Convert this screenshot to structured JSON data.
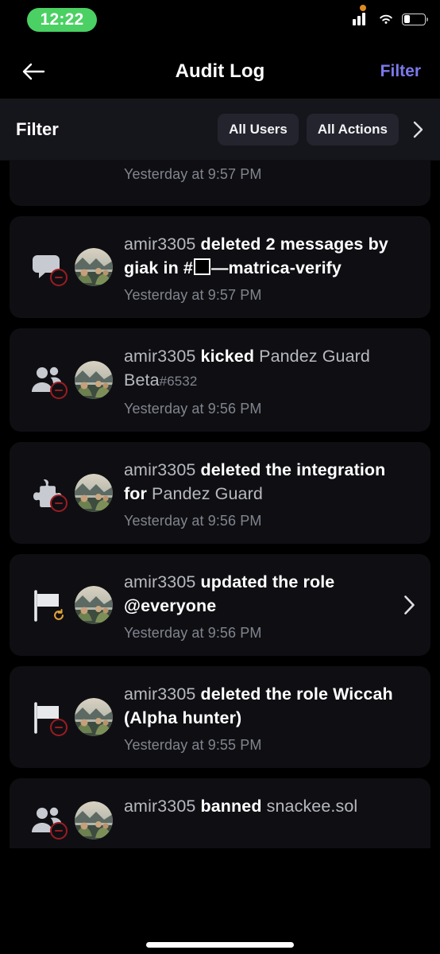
{
  "status_bar": {
    "time": "12:22",
    "time_pill_color": "#4ad063",
    "recording_dot_color": "#e08a1e",
    "icons": [
      "orange-dot",
      "cellular-signal",
      "wifi",
      "battery"
    ],
    "battery_level_percent": 30
  },
  "header": {
    "back_label": "back-arrow",
    "title": "Audit Log",
    "action_label": "Filter",
    "action_color": "#7b79ea"
  },
  "filter_bar": {
    "label": "Filter",
    "pills": [
      {
        "label": "All Users"
      },
      {
        "label": "All Actions"
      }
    ],
    "chevron": "chevron-right-icon"
  },
  "entries": [
    {
      "id": "entry-clipped-top",
      "clipped": true,
      "icon": "",
      "badge": "",
      "parts": [],
      "time": "Yesterday at 9:57 PM",
      "expandable": false
    },
    {
      "id": "entry-message-delete",
      "icon": "message-icon",
      "badge": "minus",
      "parts": [
        {
          "t": "amir3305 ",
          "s": "actor"
        },
        {
          "t": "deleted ",
          "s": "strong"
        },
        {
          "t": "2 messages",
          "s": "strong"
        },
        {
          "t": " by giak ",
          "s": "strong"
        },
        {
          "t": "in ",
          "s": "strong"
        },
        {
          "t": "#",
          "s": "strong"
        },
        {
          "t": "▯",
          "s": "tofu"
        },
        {
          "t": "—matrica-verify",
          "s": "strong"
        }
      ],
      "time": "Yesterday at 9:57 PM",
      "expandable": false
    },
    {
      "id": "entry-member-kick",
      "icon": "members-icon",
      "badge": "minus",
      "parts": [
        {
          "t": "amir3305 ",
          "s": "actor"
        },
        {
          "t": "kicked ",
          "s": "strong"
        },
        {
          "t": "Pandez Guard Beta",
          "s": "target"
        },
        {
          "t": "#6532",
          "s": "disc"
        }
      ],
      "time": "Yesterday at 9:56 PM",
      "expandable": false
    },
    {
      "id": "entry-integration-delete",
      "icon": "puzzle-icon",
      "badge": "minus",
      "parts": [
        {
          "t": "amir3305 ",
          "s": "actor"
        },
        {
          "t": "deleted the integration for ",
          "s": "strong"
        },
        {
          "t": "Pandez Guard",
          "s": "target"
        }
      ],
      "time": "Yesterday at 9:56 PM",
      "expandable": false
    },
    {
      "id": "entry-role-update",
      "icon": "flag-icon",
      "badge": "update",
      "parts": [
        {
          "t": "amir3305 ",
          "s": "actor"
        },
        {
          "t": "updated the role ",
          "s": "strong"
        },
        {
          "t": "@everyone",
          "s": "strong"
        }
      ],
      "time": "Yesterday at 9:56 PM",
      "expandable": true
    },
    {
      "id": "entry-role-delete",
      "icon": "flag-icon",
      "badge": "minus",
      "parts": [
        {
          "t": "amir3305 ",
          "s": "actor"
        },
        {
          "t": "deleted the role ",
          "s": "strong"
        },
        {
          "t": "Wiccah (Alpha hunter)",
          "s": "strong"
        }
      ],
      "time": "Yesterday at 9:55 PM",
      "expandable": false
    },
    {
      "id": "entry-member-ban",
      "cutoff": true,
      "icon": "members-icon",
      "badge": "minus",
      "parts": [
        {
          "t": "amir3305 ",
          "s": "actor"
        },
        {
          "t": "banned ",
          "s": "strong"
        },
        {
          "t": "snackee.sol",
          "s": "target"
        }
      ],
      "time": "",
      "expandable": false
    }
  ],
  "colors": {
    "page_background": "#000000",
    "card_background": "#0f0f13",
    "filter_bar_background": "#15151c",
    "pill_background": "#24242f",
    "accent": "#7b79ea",
    "muted_text": "#80848e",
    "body_text": "#b6b9bf",
    "danger_badge": "#9b1c22",
    "update_badge": "#e2a33a"
  }
}
